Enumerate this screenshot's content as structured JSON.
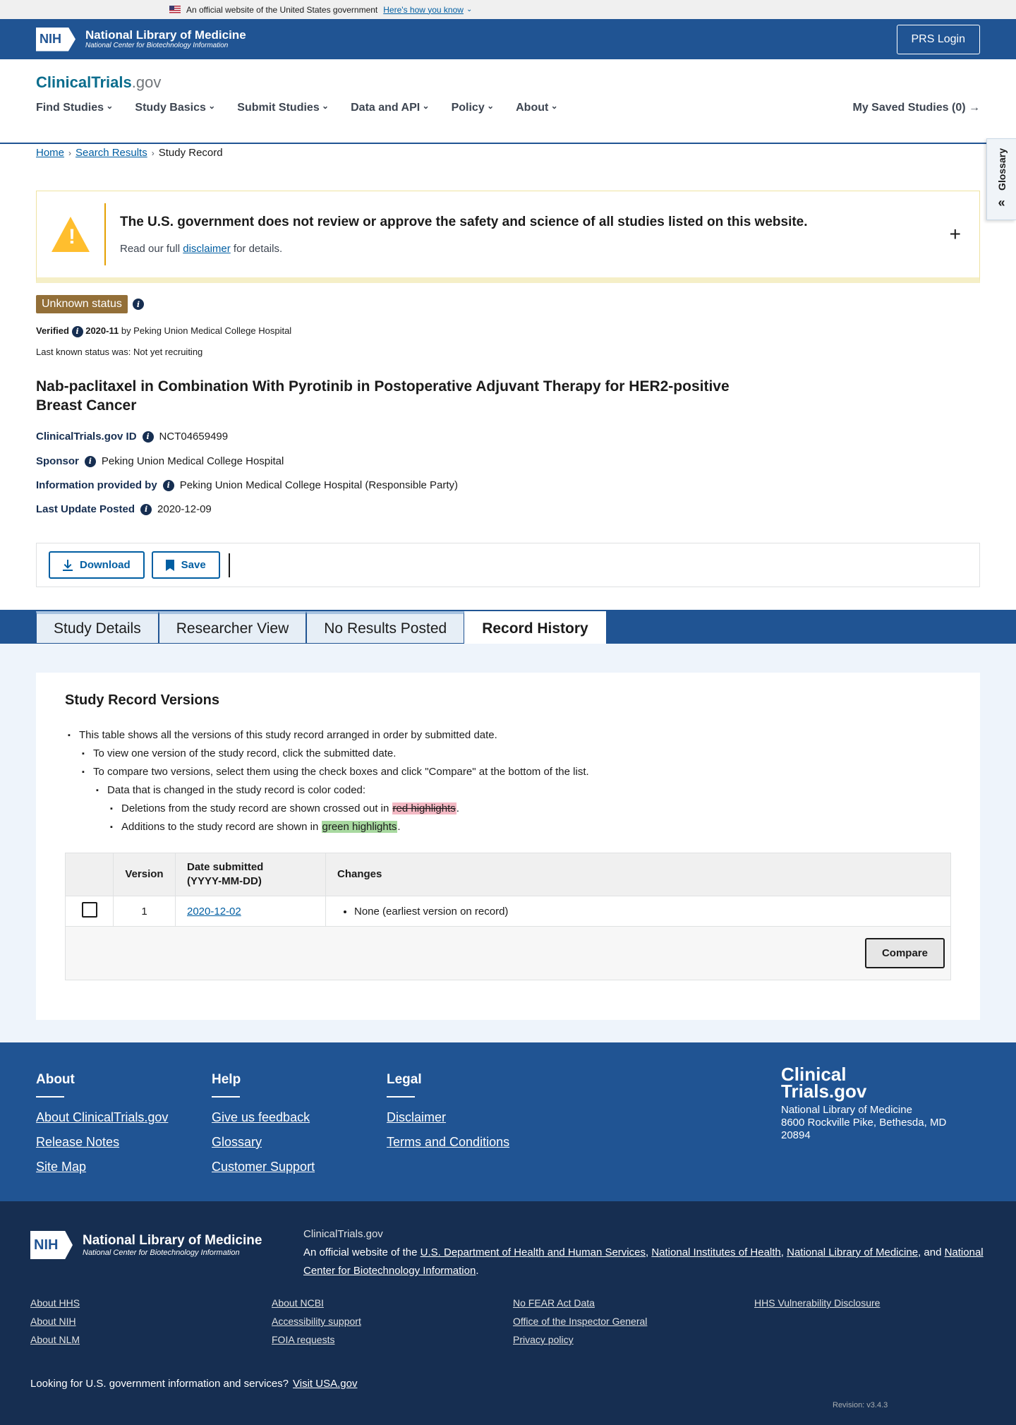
{
  "gov_banner": {
    "text": "An official website of the United States government",
    "link": "Here's how you know"
  },
  "nlm": {
    "nih": "NIH",
    "title": "National Library of Medicine",
    "subtitle": "National Center for Biotechnology Information",
    "prs_login": "PRS Login"
  },
  "header": {
    "logo_main": "ClinicalTrials",
    "logo_suffix": ".gov",
    "nav": [
      "Find Studies",
      "Study Basics",
      "Submit Studies",
      "Data and API",
      "Policy",
      "About"
    ],
    "saved": "My Saved Studies (0)"
  },
  "glossary": {
    "label": "Glossary"
  },
  "breadcrumb": {
    "home": "Home",
    "search": "Search Results",
    "current": "Study Record"
  },
  "disclaimer": {
    "heading": "The U.S. government does not review or approve the safety and science of all studies listed on this website.",
    "pre": "Read our full",
    "link": "disclaimer",
    "post": "for details."
  },
  "status": {
    "badge": "Unknown status",
    "verified_label": "Verified",
    "verified_date": "2020-11",
    "verified_by": "by Peking Union Medical College Hospital",
    "last_known": "Last known status was: Not yet recruiting"
  },
  "study": {
    "title": "Nab-paclitaxel in Combination With Pyrotinib in Postoperative Adjuvant Therapy for HER2-positive Breast Cancer",
    "id_label": "ClinicalTrials.gov ID",
    "id": "NCT04659499",
    "sponsor_label": "Sponsor",
    "sponsor": "Peking Union Medical College Hospital",
    "info_label": "Information provided by",
    "info": "Peking Union Medical College Hospital (Responsible Party)",
    "update_label": "Last Update Posted",
    "update": "2020-12-09"
  },
  "toolbar": {
    "download": "Download",
    "save": "Save"
  },
  "tabs": [
    "Study Details",
    "Researcher View",
    "No Results Posted",
    "Record History"
  ],
  "versions": {
    "heading": "Study Record Versions",
    "b1": "This table shows all the versions of this study record arranged in order by submitted date.",
    "b2": "To view one version of the study record, click the submitted date.",
    "b3": "To compare two versions, select them using the check boxes and click \"Compare\" at the bottom of the list.",
    "b4": "Data that is changed in the study record is color coded:",
    "b5_pre": "Deletions from the study record are shown crossed out in",
    "b5_mark": "red highlights",
    "b6_pre": "Additions to the study record are shown in",
    "b6_mark": "green highlights",
    "period": ".",
    "th_version": "Version",
    "th_date_1": "Date submitted",
    "th_date_2": "(YYYY-MM-DD)",
    "th_changes": "Changes",
    "rows": [
      {
        "version": "1",
        "date": "2020-12-02",
        "change": "None (earliest version on record)"
      }
    ],
    "compare": "Compare"
  },
  "footer": {
    "about": {
      "h": "About",
      "links": [
        "About ClinicalTrials.gov",
        "Release Notes",
        "Site Map"
      ]
    },
    "help": {
      "h": "Help",
      "links": [
        "Give us feedback",
        "Glossary",
        "Customer Support"
      ]
    },
    "legal": {
      "h": "Legal",
      "links": [
        "Disclaimer",
        "Terms and Conditions"
      ]
    },
    "brand_1": "Clinical",
    "brand_2": "Trials.gov",
    "addr_1": "National Library of Medicine",
    "addr_2": "8600 Rockville Pike, Bethesda, MD 20894"
  },
  "footer_bottom": {
    "site": "ClinicalTrials.gov",
    "official_pre": "An official website of the",
    "hhs": "U.S. Department of Health and Human Services",
    "nih": "National Institutes of Health",
    "nlm": "National Library of Medicine",
    "and": "and",
    "ncbi": "National Center for Biotechnology Information",
    "links": [
      "About HHS",
      "About NCBI",
      "No FEAR Act Data",
      "HHS Vulnerability Disclosure",
      "About NIH",
      "Accessibility support",
      "Office of the Inspector General",
      "About NLM",
      "FOIA requests",
      "Privacy policy"
    ],
    "looking": "Looking for U.S. government information and services?",
    "usa": "Visit USA.gov",
    "revision": "Revision: v3.4.3"
  }
}
